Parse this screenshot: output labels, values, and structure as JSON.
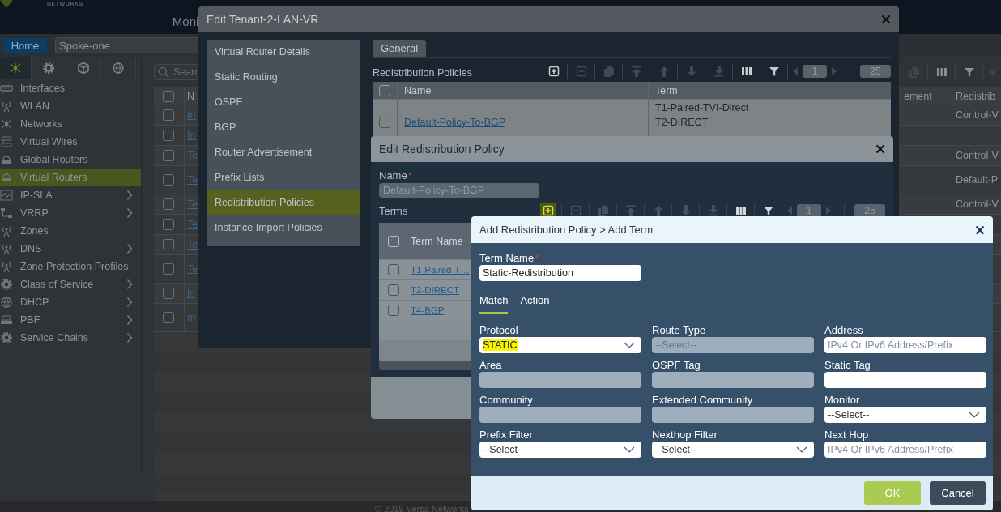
{
  "header": {
    "brand_subtitle": "NETWORKS",
    "tab": "Moni"
  },
  "context_bar": {
    "home_button": "Home",
    "appliance": "Spoke-one"
  },
  "sidebar": {
    "icon_tabs": [
      {
        "selected": true
      },
      {
        "selected": false
      },
      {
        "selected": false
      },
      {
        "selected": false
      }
    ],
    "items": [
      {
        "label": "Interfaces",
        "selected": false,
        "submenu": false
      },
      {
        "label": "WLAN",
        "selected": false,
        "submenu": false
      },
      {
        "label": "Networks",
        "selected": false,
        "submenu": false
      },
      {
        "label": "Virtual Wires",
        "selected": false,
        "submenu": false
      },
      {
        "label": "Global Routers",
        "selected": false,
        "submenu": false
      },
      {
        "label": "Virtual Routers",
        "selected": true,
        "submenu": false
      },
      {
        "label": "IP-SLA",
        "selected": false,
        "submenu": true
      },
      {
        "label": "VRRP",
        "selected": false,
        "submenu": true
      },
      {
        "label": "Zones",
        "selected": false,
        "submenu": false
      },
      {
        "label": "DNS",
        "selected": false,
        "submenu": true
      },
      {
        "label": "Zone Protection Profiles",
        "selected": false,
        "submenu": false
      },
      {
        "label": "Class of Service",
        "selected": false,
        "submenu": true
      },
      {
        "label": "DHCP",
        "selected": false,
        "submenu": true
      },
      {
        "label": "PBF",
        "selected": false,
        "submenu": true
      },
      {
        "label": "Service Chains",
        "selected": false,
        "submenu": true
      }
    ]
  },
  "search": {
    "placeholder": "Searc"
  },
  "toolbar": {
    "tools": [
      {
        "disabled": true
      },
      {
        "disabled": false
      },
      {
        "disabled": false
      },
      {
        "disabled": true
      }
    ]
  },
  "table": {
    "header_checked": false,
    "columns": [
      "N",
      "ement",
      "Redistrib"
    ],
    "rows": [
      {
        "checked": false,
        "name": "In",
        "redistribution": "Control-V"
      },
      {
        "checked": false,
        "name": "In"
      },
      {
        "checked": false,
        "name": "Te",
        "redistribution": "Control-V"
      },
      {
        "checked": false,
        "name": "Te",
        "redistribution": "Default-P"
      },
      {
        "checked": false,
        "name": "Te",
        "redistribution": "Control-V"
      },
      {
        "checked": false,
        "name": "Te"
      },
      {
        "checked": false,
        "name": "Te"
      },
      {
        "checked": false,
        "name": "Te"
      },
      {
        "checked": false,
        "name": "in"
      },
      {
        "checked": false,
        "name": "m"
      }
    ]
  },
  "copyright": "© 2019 Versa Networks",
  "tenant_dialog": {
    "title": "Edit Tenant-2-LAN-VR",
    "nav": [
      {
        "label": "Virtual Router Details",
        "selected": false
      },
      {
        "label": "Static Routing",
        "selected": false
      },
      {
        "label": "OSPF",
        "selected": false
      },
      {
        "label": "BGP",
        "selected": false
      },
      {
        "label": "Router Advertisement",
        "selected": false
      },
      {
        "label": "Prefix Lists",
        "selected": false
      },
      {
        "label": "Redistribution Policies",
        "selected": true
      },
      {
        "label": "Instance Import Policies",
        "selected": false
      }
    ],
    "tabs": [
      {
        "label": "General",
        "selected": true
      }
    ],
    "section_title": "Redistribution Policies",
    "toolbar": {
      "tools": [
        {
          "disabled": false,
          "highlighted": false
        },
        {
          "disabled": true,
          "highlighted": false
        },
        {
          "disabled": true,
          "highlighted": false
        },
        {
          "disabled": true,
          "highlighted": false
        },
        {
          "disabled": true,
          "highlighted": false
        },
        {
          "disabled": true,
          "highlighted": false
        },
        {
          "disabled": true,
          "highlighted": false
        },
        {
          "disabled": false,
          "highlighted": false
        },
        {
          "disabled": false,
          "highlighted": false
        },
        {
          "disabled": true,
          "highlighted": false
        },
        {
          "disabled": true,
          "highlighted": false
        }
      ],
      "page": "1",
      "page_size": "25"
    },
    "table": {
      "header_checked": false,
      "columns": [
        "Name",
        "Term"
      ],
      "rows": [
        {
          "checked": false,
          "name": "Default-Policy-To-BGP",
          "terms": [
            "T1-Paired-TVI-Direct",
            "T2-DIRECT"
          ]
        }
      ]
    }
  },
  "policy_dialog": {
    "title": "Edit Redistribution Policy",
    "name": {
      "label": "Name",
      "required_mark": "*",
      "value": "Default-Policy-To-BGP",
      "disabled": true
    },
    "terms_label": "Terms",
    "toolbar": {
      "tools": [
        {
          "disabled": false,
          "highlighted": true
        },
        {
          "disabled": true,
          "highlighted": false
        },
        {
          "disabled": true,
          "highlighted": false
        },
        {
          "disabled": true,
          "highlighted": false
        },
        {
          "disabled": true,
          "highlighted": false
        },
        {
          "disabled": true,
          "highlighted": false
        },
        {
          "disabled": true,
          "highlighted": false
        },
        {
          "disabled": false,
          "highlighted": false
        },
        {
          "disabled": false,
          "highlighted": false
        },
        {
          "disabled": true,
          "highlighted": false
        },
        {
          "disabled": true,
          "highlighted": false
        }
      ],
      "page": "1",
      "page_size": "25"
    },
    "table": {
      "header_checked": false,
      "columns": [
        "Term Name"
      ],
      "rows": [
        {
          "checked": false,
          "name": "T1-Paired-T…"
        },
        {
          "checked": false,
          "name": "T2-DIRECT"
        },
        {
          "checked": false,
          "name": "T4-BGP"
        }
      ]
    }
  },
  "term_dialog": {
    "title": "Add Redistribution Policy > Add Term",
    "term_name": {
      "label": "Term Name",
      "required_mark": "*",
      "value": "Static-Redistribution"
    },
    "tabs": [
      {
        "label": "Match",
        "selected": true
      },
      {
        "label": "Action",
        "selected": false
      }
    ],
    "fields": [
      {
        "label": "Protocol",
        "kind": "select",
        "value": "STATIC",
        "highlighted": true
      },
      {
        "label": "Route Type",
        "kind": "disabled",
        "value": "--Select--"
      },
      {
        "label": "Address",
        "kind": "text",
        "placeholder": "IPv4 Or IPv6 Address/Prefix"
      },
      {
        "label": "Area",
        "kind": "disabled"
      },
      {
        "label": "OSPF Tag",
        "kind": "disabled"
      },
      {
        "label": "Static Tag",
        "kind": "text"
      },
      {
        "label": "Community",
        "kind": "disabled"
      },
      {
        "label": "Extended Community",
        "kind": "disabled"
      },
      {
        "label": "Monitor",
        "kind": "select",
        "value": "--Select--"
      },
      {
        "label": "Prefix Filter",
        "kind": "select",
        "value": "--Select--"
      },
      {
        "label": "Nexthop Filter",
        "kind": "select",
        "value": "--Select--"
      },
      {
        "label": "Next Hop",
        "kind": "text",
        "placeholder": "IPv4 Or IPv6 Address/Prefix"
      }
    ],
    "buttons": [
      {
        "label": "OK",
        "kind": "primary"
      },
      {
        "label": "Cancel",
        "kind": "secondary"
      }
    ]
  }
}
